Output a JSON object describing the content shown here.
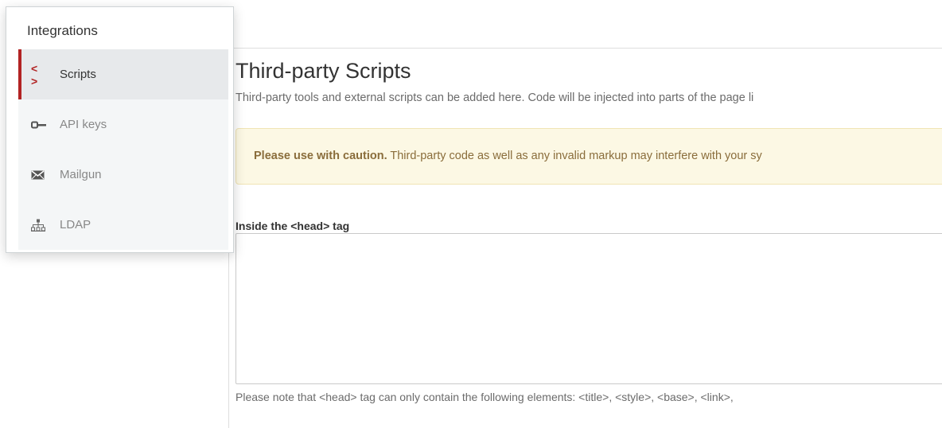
{
  "sidebar": {
    "title": "Integrations",
    "items": [
      {
        "label": "Scripts",
        "icon": "code-icon",
        "active": true
      },
      {
        "label": "API keys",
        "icon": "key-icon",
        "active": false
      },
      {
        "label": "Mailgun",
        "icon": "envelope-icon",
        "active": false
      },
      {
        "label": "LDAP",
        "icon": "sitemap-icon",
        "active": false
      }
    ]
  },
  "main": {
    "title": "Third-party Scripts",
    "description": "Third-party tools and external scripts can be added here. Code will be injected into parts of the page li",
    "alert": {
      "bold": "Please use with caution.",
      "text": " Third-party code as well as any invalid markup may interfere with your sy"
    },
    "head_section": {
      "label": "Inside the <head> tag",
      "value": "",
      "help": "Please note that <head> tag can only contain the following elements: <title>, <style>, <base>, <link>,"
    }
  },
  "colors": {
    "accent": "#b22323",
    "alert_background": "#fcf8e4",
    "alert_text": "#8a6d3b"
  }
}
